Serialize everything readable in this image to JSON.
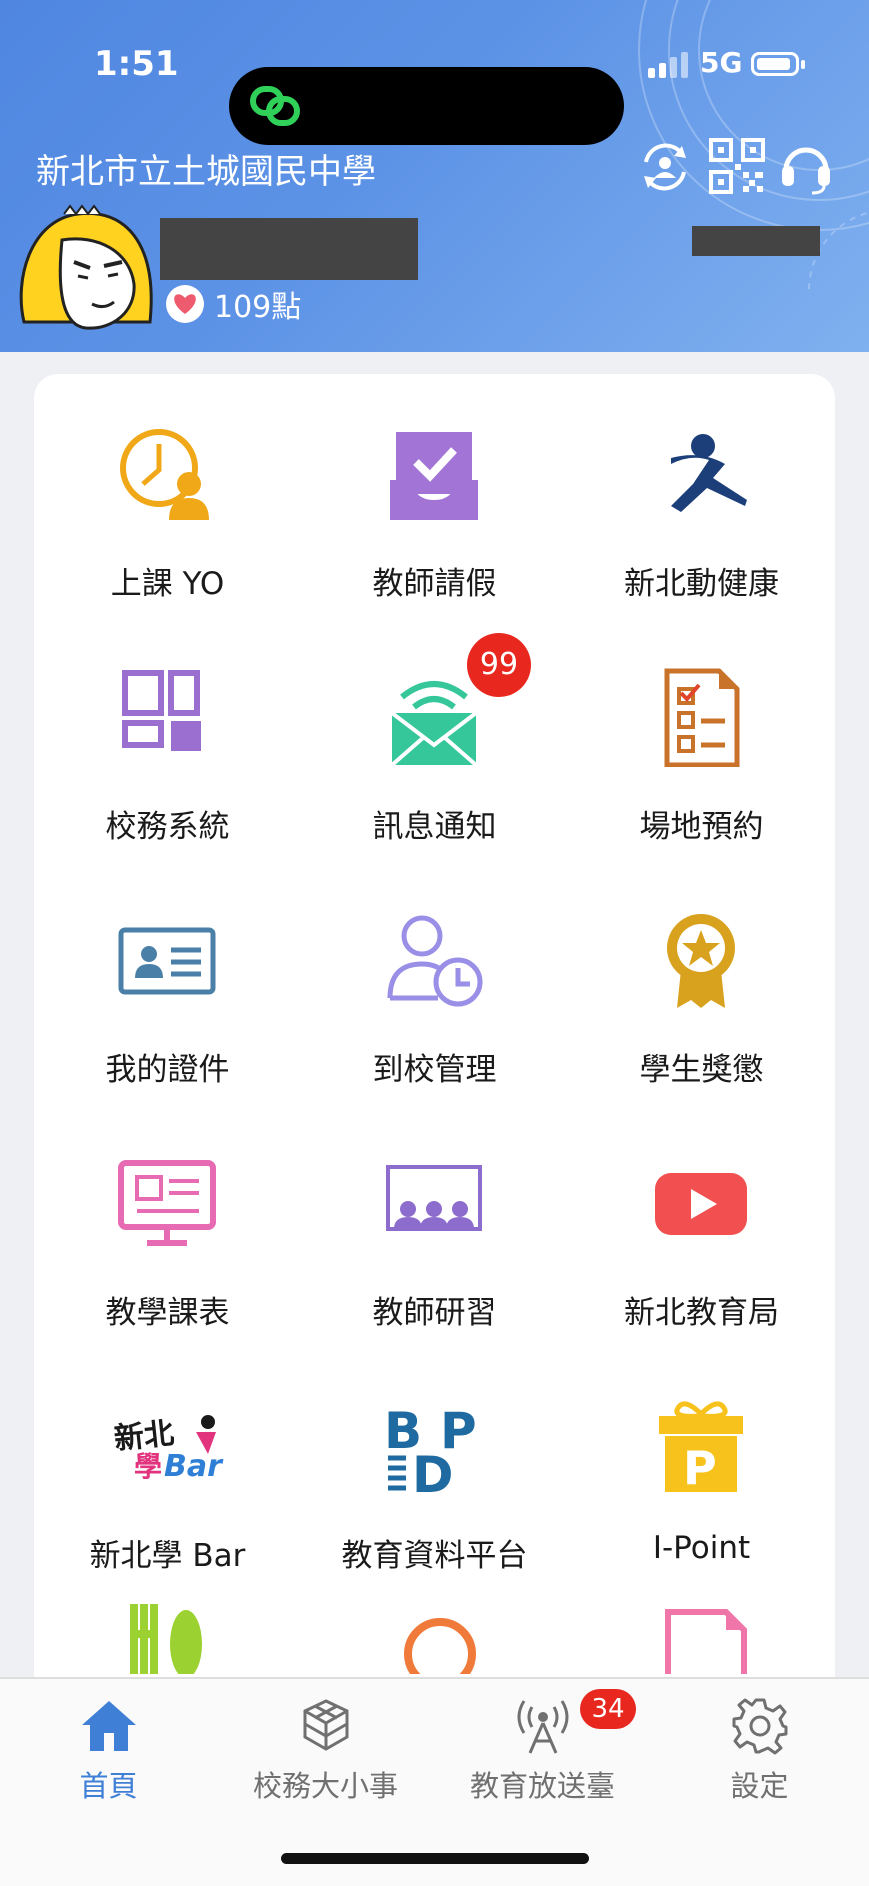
{
  "status_bar": {
    "time": "1:51",
    "network": "5G"
  },
  "header": {
    "school_name": "新北市立土城國民中學",
    "points": "109點",
    "icons": [
      "account-switch-icon",
      "qr-code-icon",
      "headset-icon"
    ]
  },
  "apps": [
    {
      "label": "上課 YO",
      "icon": "clock-person-icon"
    },
    {
      "label": "教師請假",
      "icon": "inbox-check-icon"
    },
    {
      "label": "新北動健康",
      "icon": "runner-icon"
    },
    {
      "label": "校務系統",
      "icon": "grid-icon"
    },
    {
      "label": "訊息通知",
      "icon": "mail-wifi-icon",
      "badge": "99"
    },
    {
      "label": "場地預約",
      "icon": "checklist-icon"
    },
    {
      "label": "我的證件",
      "icon": "id-card-icon"
    },
    {
      "label": "到校管理",
      "icon": "person-clock-icon"
    },
    {
      "label": "學生獎懲",
      "icon": "award-icon"
    },
    {
      "label": "教學課表",
      "icon": "monitor-icon"
    },
    {
      "label": "教師研習",
      "icon": "audience-icon"
    },
    {
      "label": "新北教育局",
      "icon": "youtube-icon"
    },
    {
      "label": "新北學 Bar",
      "icon": "xuebar-logo",
      "logo_text": "新北學Bar"
    },
    {
      "label": "教育資料平台",
      "icon": "bdp-logo",
      "logo_text": "BDP"
    },
    {
      "label": "I-Point",
      "icon": "gift-p-icon",
      "logo_text": "P"
    }
  ],
  "tabbar": {
    "tabs": [
      {
        "label": "首頁",
        "icon": "home-icon",
        "active": true
      },
      {
        "label": "校務大小事",
        "icon": "cubes-icon"
      },
      {
        "label": "教育放送臺",
        "icon": "broadcast-icon",
        "badge": "34"
      },
      {
        "label": "設定",
        "icon": "gear-icon"
      }
    ]
  },
  "colors": {
    "header_blue": "#4f86e0",
    "accent_blue": "#3f7fd6",
    "badge_red": "#e8271e"
  }
}
